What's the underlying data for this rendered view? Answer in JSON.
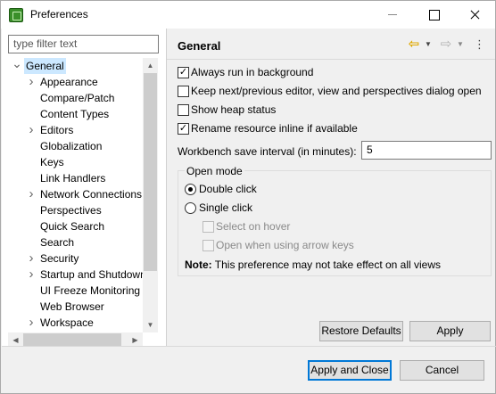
{
  "window": {
    "title": "Preferences",
    "icon": "eclipse-app-icon"
  },
  "filter": {
    "placeholder": "type filter text"
  },
  "tree": [
    {
      "label": "General",
      "arrow": "expanded",
      "level": 0,
      "selected": true
    },
    {
      "label": "Appearance",
      "arrow": "collapsed",
      "level": 1
    },
    {
      "label": "Compare/Patch",
      "arrow": "none",
      "level": 1
    },
    {
      "label": "Content Types",
      "arrow": "none",
      "level": 1
    },
    {
      "label": "Editors",
      "arrow": "collapsed",
      "level": 1
    },
    {
      "label": "Globalization",
      "arrow": "none",
      "level": 1
    },
    {
      "label": "Keys",
      "arrow": "none",
      "level": 1
    },
    {
      "label": "Link Handlers",
      "arrow": "none",
      "level": 1
    },
    {
      "label": "Network Connections",
      "arrow": "collapsed",
      "level": 1
    },
    {
      "label": "Perspectives",
      "arrow": "none",
      "level": 1
    },
    {
      "label": "Quick Search",
      "arrow": "none",
      "level": 1
    },
    {
      "label": "Search",
      "arrow": "none",
      "level": 1
    },
    {
      "label": "Security",
      "arrow": "collapsed",
      "level": 1
    },
    {
      "label": "Startup and Shutdown",
      "arrow": "collapsed",
      "level": 1
    },
    {
      "label": "UI Freeze Monitoring",
      "arrow": "none",
      "level": 1
    },
    {
      "label": "Web Browser",
      "arrow": "none",
      "level": 1
    },
    {
      "label": "Workspace",
      "arrow": "collapsed",
      "level": 1
    }
  ],
  "page": {
    "title": "General",
    "options": [
      {
        "label": "Always run in background",
        "checked": true
      },
      {
        "label": "Keep next/previous editor, view and perspectives dialog open",
        "checked": false
      },
      {
        "label": "Show heap status",
        "checked": false
      },
      {
        "label": "Rename resource inline if available",
        "checked": true
      }
    ],
    "save_interval_label": "Workbench save interval (in minutes):",
    "save_interval_value": "5",
    "open_mode": {
      "title": "Open mode",
      "double_click": "Double click",
      "single_click": "Single click",
      "selected": "double",
      "select_on_hover": "Select on hover",
      "open_arrow_keys": "Open when using arrow keys",
      "note_label": "Note:",
      "note_text": " This preference may not take effect on all views"
    },
    "restore_defaults": "Restore Defaults",
    "apply": "Apply"
  },
  "footer": {
    "apply_close": "Apply and Close",
    "cancel": "Cancel"
  }
}
